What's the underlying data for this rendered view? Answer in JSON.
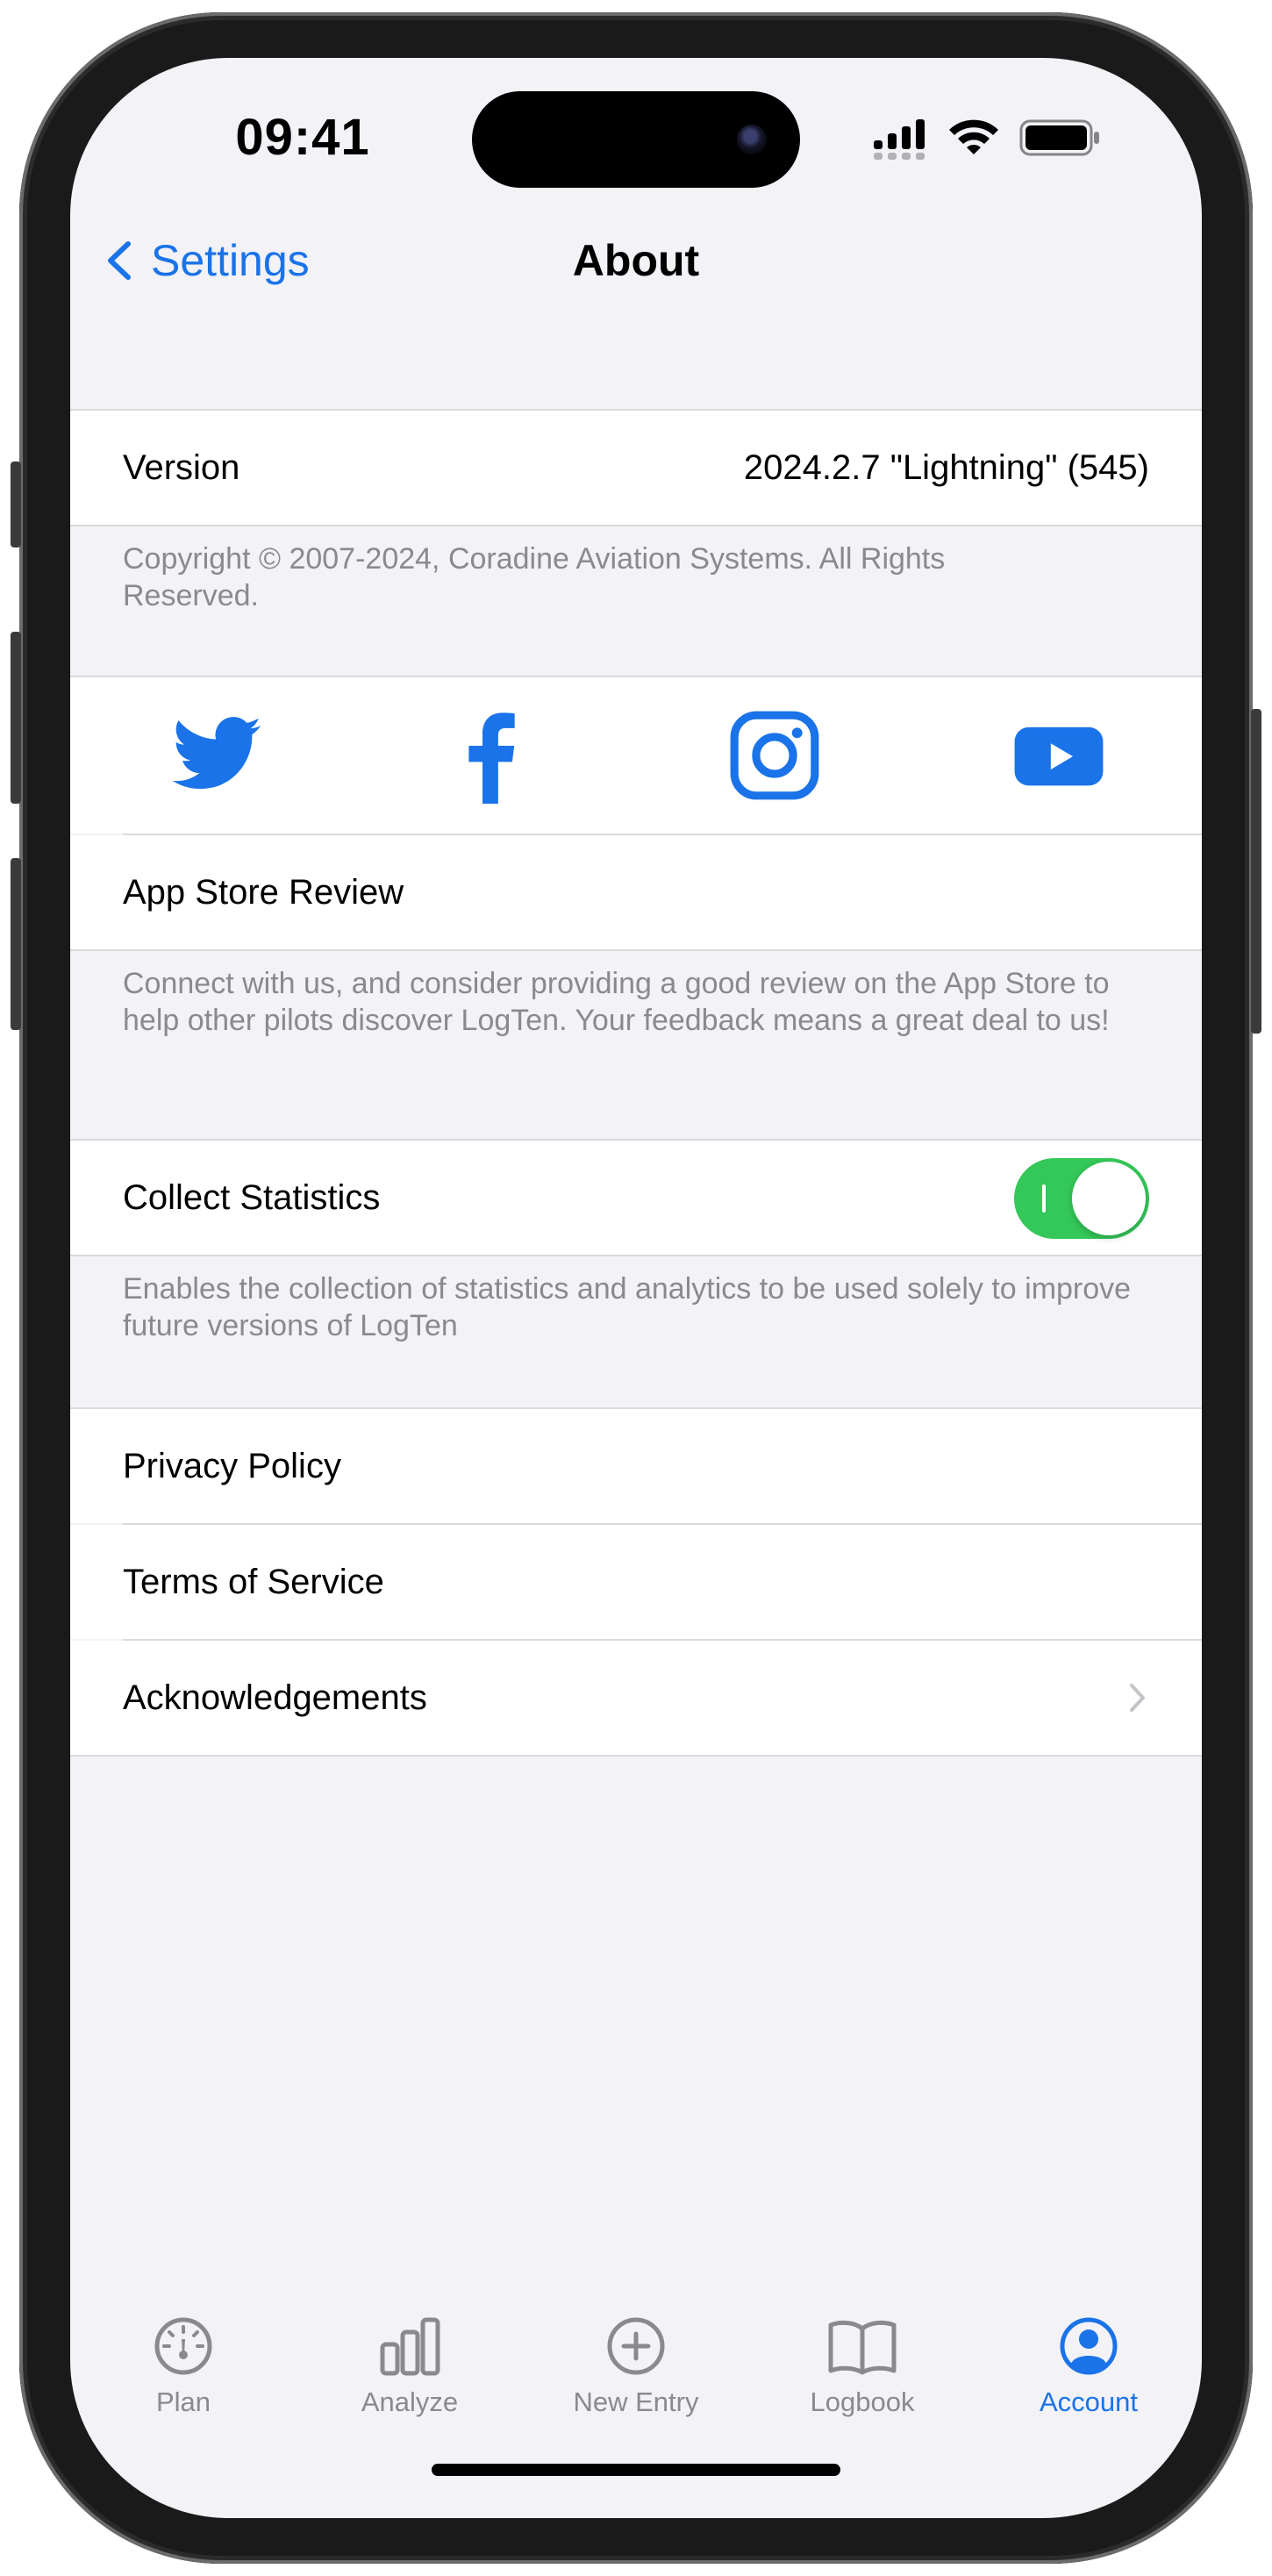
{
  "status_bar": {
    "time": "09:41"
  },
  "nav": {
    "back_label": "Settings",
    "title": "About"
  },
  "version_row": {
    "label": "Version",
    "value": "2024.2.7 \"Lightning\" (545)"
  },
  "copyright_text": "Copyright © 2007-2024, Coradine Aviation Systems. All Rights Reserved.",
  "social": {
    "icons": [
      "twitter-icon",
      "facebook-icon",
      "instagram-icon",
      "youtube-icon"
    ],
    "review_label": "App Store Review",
    "footer": "Connect with us, and consider providing a good review on the App Store to help other pilots discover LogTen. Your feedback means a great deal to us!"
  },
  "statistics": {
    "label": "Collect Statistics",
    "enabled": true,
    "footer": "Enables the collection of statistics and analytics to be used solely to improve future versions of LogTen"
  },
  "links": [
    {
      "label": "Privacy Policy"
    },
    {
      "label": "Terms of Service"
    },
    {
      "label": "Acknowledgements"
    }
  ],
  "tab_bar": [
    {
      "label": "Plan",
      "icon": "gauge-icon",
      "active": false
    },
    {
      "label": "Analyze",
      "icon": "bar-chart-icon",
      "active": false
    },
    {
      "label": "New Entry",
      "icon": "plus-circle-icon",
      "active": false
    },
    {
      "label": "Logbook",
      "icon": "book-icon",
      "active": false
    },
    {
      "label": "Account",
      "icon": "person-circle-icon",
      "active": true
    }
  ],
  "colors": {
    "accent": "#1a73e8",
    "background": "#f2f2f7",
    "toggle_on": "#34c759",
    "secondary_text": "#8a8a8e"
  }
}
